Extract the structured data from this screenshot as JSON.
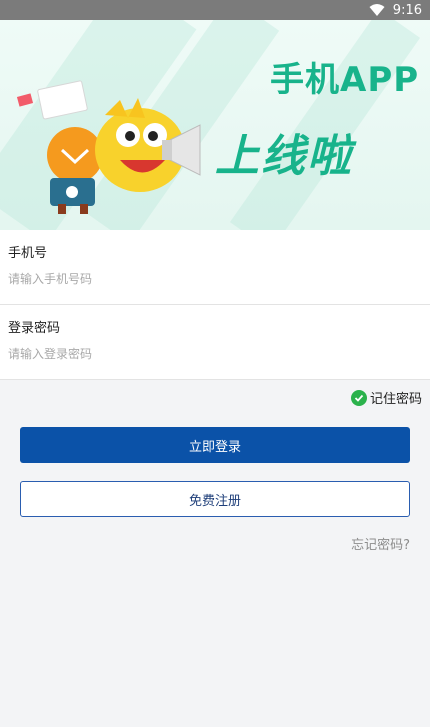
{
  "status_bar": {
    "time": "9:16",
    "wifi_icon": "wifi-icon"
  },
  "banner": {
    "title": "手机APP",
    "subtitle": "上线啦"
  },
  "form": {
    "phone": {
      "label": "手机号",
      "placeholder": "请输入手机号码",
      "value": ""
    },
    "password": {
      "label": "登录密码",
      "placeholder": "请输入登录密码",
      "value": ""
    }
  },
  "remember": {
    "label": "记住密码",
    "checked": true,
    "icon": "check-circle-icon",
    "color": "#2bb24c"
  },
  "buttons": {
    "login": "立即登录",
    "register": "免费注册"
  },
  "forgot_link": "忘记密码?",
  "colors": {
    "primary": "#0b52a8",
    "accent_green": "#18b38b"
  }
}
